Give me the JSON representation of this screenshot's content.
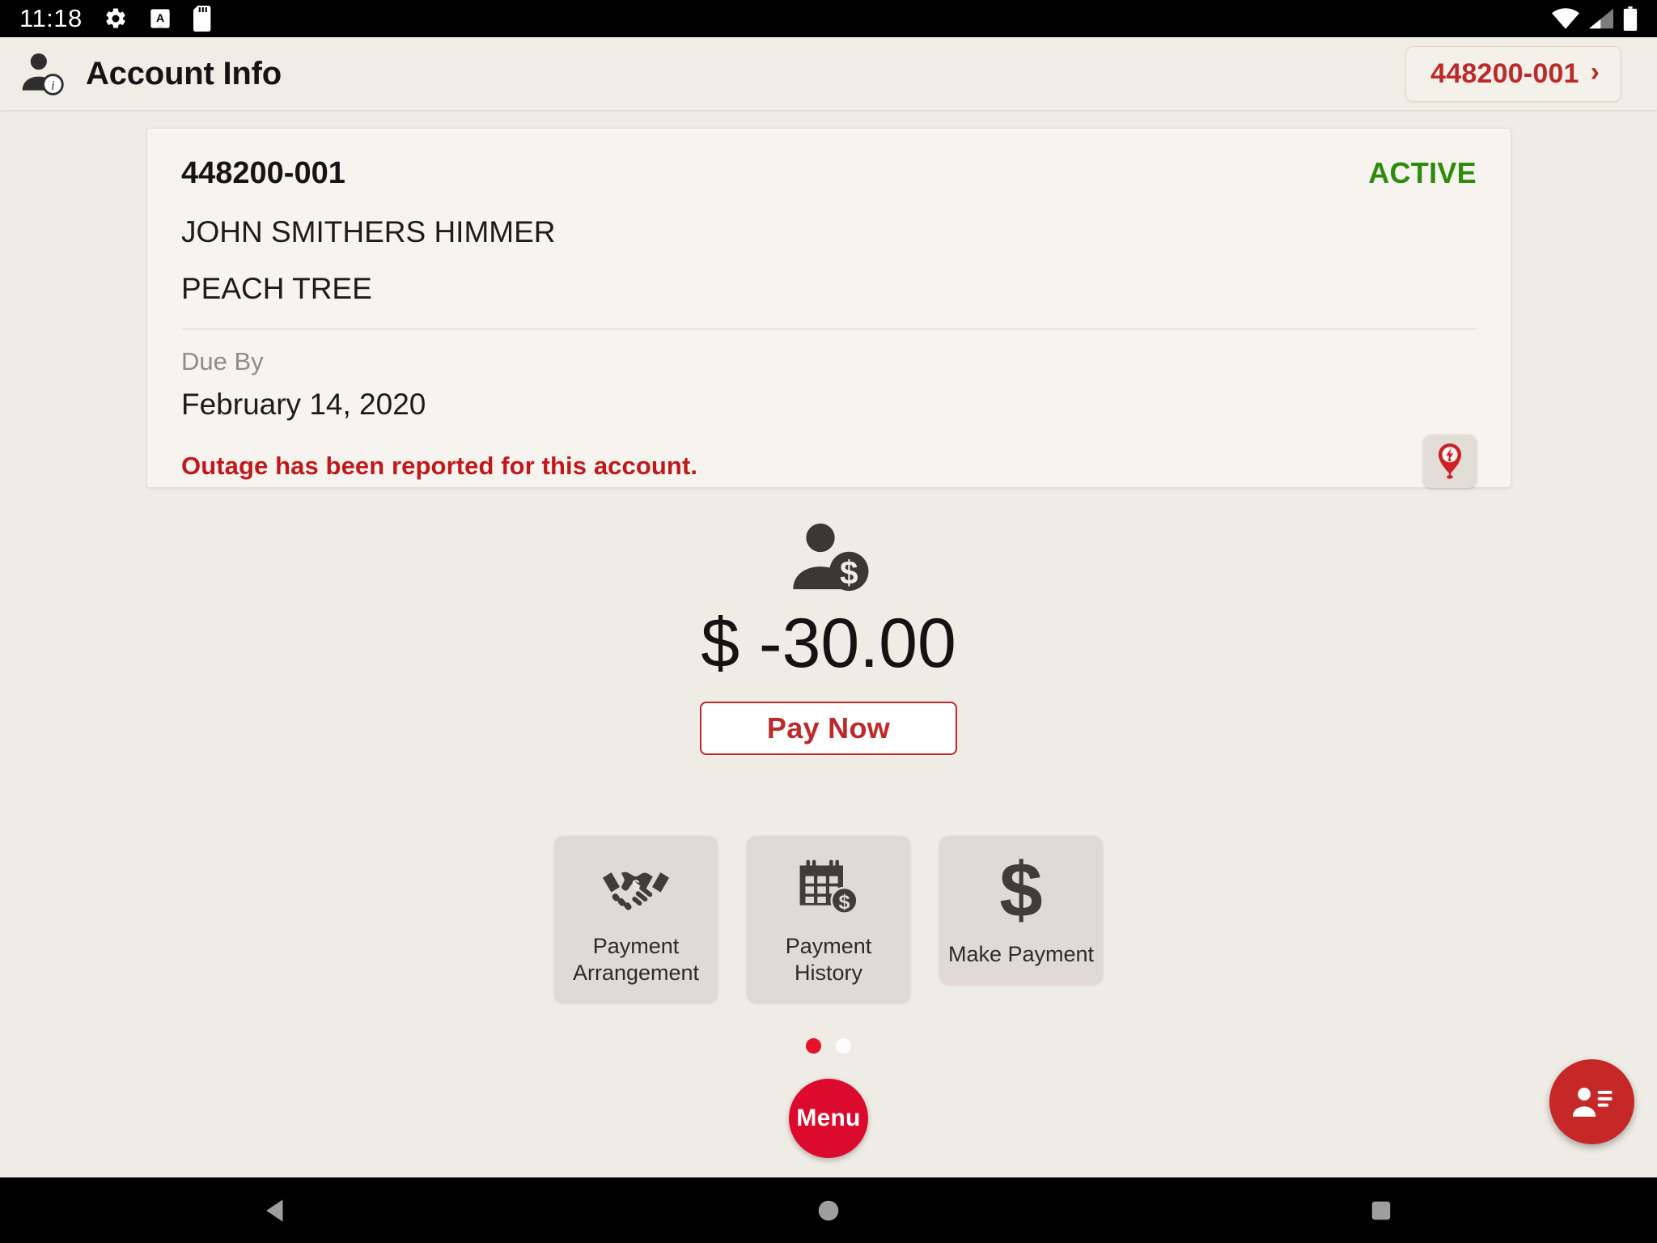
{
  "status_bar": {
    "time": "11:18",
    "left_icons": [
      "gear-icon",
      "a-letter-box-icon",
      "sd-card-icon"
    ],
    "right_icons": [
      "wifi-icon",
      "cellular-signal-icon",
      "battery-icon"
    ]
  },
  "header": {
    "title": "Account Info",
    "title_icon": "account-info-icon",
    "account_chip": {
      "label": "448200-001",
      "chevron": "›"
    }
  },
  "account_card": {
    "account_number": "448200-001",
    "status": "ACTIVE",
    "status_color": "#2e8b0b",
    "customer_name": "JOHN SMITHERS HIMMER",
    "address": "PEACH TREE",
    "due_by_label": "Due By",
    "due_by_date": "February 14, 2020",
    "outage_message": "Outage has been reported for this account.",
    "outage_message_color": "#c0191c",
    "outage_icon": "outage-pin-icon"
  },
  "balance": {
    "icon": "customer-balance-icon",
    "amount": "$ -30.00",
    "pay_now_label": "Pay Now",
    "accent_color": "#bc2a29"
  },
  "tiles": [
    {
      "icon": "handshake-dollar-icon",
      "label": "Payment\nArrangement",
      "line1": "Payment",
      "line2": "Arrangement"
    },
    {
      "icon": "calendar-dollar-icon",
      "label": "Payment\nHistory",
      "line1": "Payment",
      "line2": "History"
    },
    {
      "icon": "dollar-sign-icon",
      "label": "Make Payment",
      "line1": "Make Payment",
      "line2": ""
    }
  ],
  "pagination": {
    "total": 2,
    "active_index": 0,
    "active_color": "#e8112a",
    "inactive_color": "#fdfdfd"
  },
  "menu_button": {
    "label": "Menu",
    "color": "#dc0a2d"
  },
  "contacts_fab": {
    "icon": "contact-list-icon",
    "color": "#c62828"
  },
  "nav_bar": {
    "back": "back-triangle-icon",
    "home": "home-circle-icon",
    "recents": "recents-square-icon"
  }
}
